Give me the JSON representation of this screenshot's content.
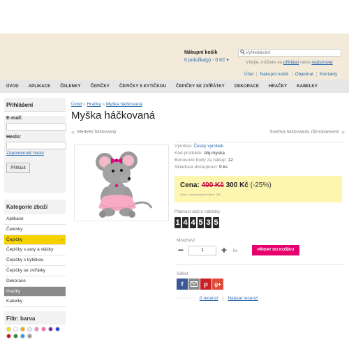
{
  "header": {
    "cart_title": "Nákupní košík",
    "cart_info": "0 položka(y) - 0 Kč",
    "cart_caret": "▾",
    "search_placeholder": "Vyhledávání",
    "welcome_text": "Vítejte, můžete se",
    "welcome_login": "přihlásit",
    "welcome_or": "nebo",
    "welcome_register": "registrovat",
    "links": [
      "Účet",
      "Nákupní košík",
      "Objednat",
      "Kontakty"
    ]
  },
  "nav": [
    "ÚVOD",
    "APLIKACE",
    "ČELENKY",
    "ČEPIČKY",
    "ČEPIČKY S KYTIČKOU",
    "ČEPIČKY SE ZVÍŘÁTKY",
    "DEKORACE",
    "HRAČKY",
    "KABELKY"
  ],
  "login": {
    "title": "Přihlášení",
    "email_label": "E-mail:",
    "password_label": "Heslo:",
    "forgot": "Zapomenuté heslo",
    "button": "Přihlásit"
  },
  "categories": {
    "title": "Kategorie zboží",
    "items": [
      "Aplikace",
      "Čelenky",
      "Čepičky",
      "Čepičky s auty a vláčky",
      "Čepičky s kytičkou",
      "Čepičky se zvířátky",
      "Dekorace",
      "Hračky",
      "Kabelky"
    ],
    "selected": "Čepičky",
    "active": "Hračky"
  },
  "filter": {
    "title": "Filtr: barva",
    "colors": [
      "#f5e400",
      "#ffffff",
      "#f7a400",
      "#e8e8e8",
      "#f08bbf",
      "#ff69b4",
      "#7b1fa2",
      "#1a3fd1",
      "#e00000",
      "#2e7d32",
      "#1aa0e0",
      "#999999"
    ]
  },
  "breadcrumb": [
    "Úvod",
    "Hračky",
    "Myška háčkovaná"
  ],
  "breadcrumb_sep": "»",
  "product": {
    "title": "Myška háčkovaná",
    "prev": "Medvěd háčkovaný",
    "next": "Sovička háčkovaná, různobarevná",
    "maker_label": "Výrobce:",
    "maker": "Český výrobek",
    "code_label": "Kód produktu:",
    "code": "obj-myska",
    "bonus_label": "Bonusové body za nákup:",
    "bonus": "12",
    "stock_label": "Skladová dostupnost:",
    "stock": "9 ks",
    "price_label": "Cena:",
    "old_price": "400 Kč",
    "new_price": "300 Kč",
    "discount": "(-25%)",
    "price_note": "Cena v bonusových bodech: 300",
    "offer_label": "Platnost akční nabídky",
    "counter": [
      "1",
      "4",
      "4",
      "5",
      "3",
      "5"
    ],
    "qty_label": "Množství",
    "qty": "1",
    "qty_minus": "−",
    "qty_plus": "+",
    "qty_unit": "ks",
    "buy": "PŘIDAT DO KOŠÍKU",
    "share_label": "Sdílet",
    "reviews": "0 recenzí",
    "write_review": "Napsat recenzi"
  }
}
